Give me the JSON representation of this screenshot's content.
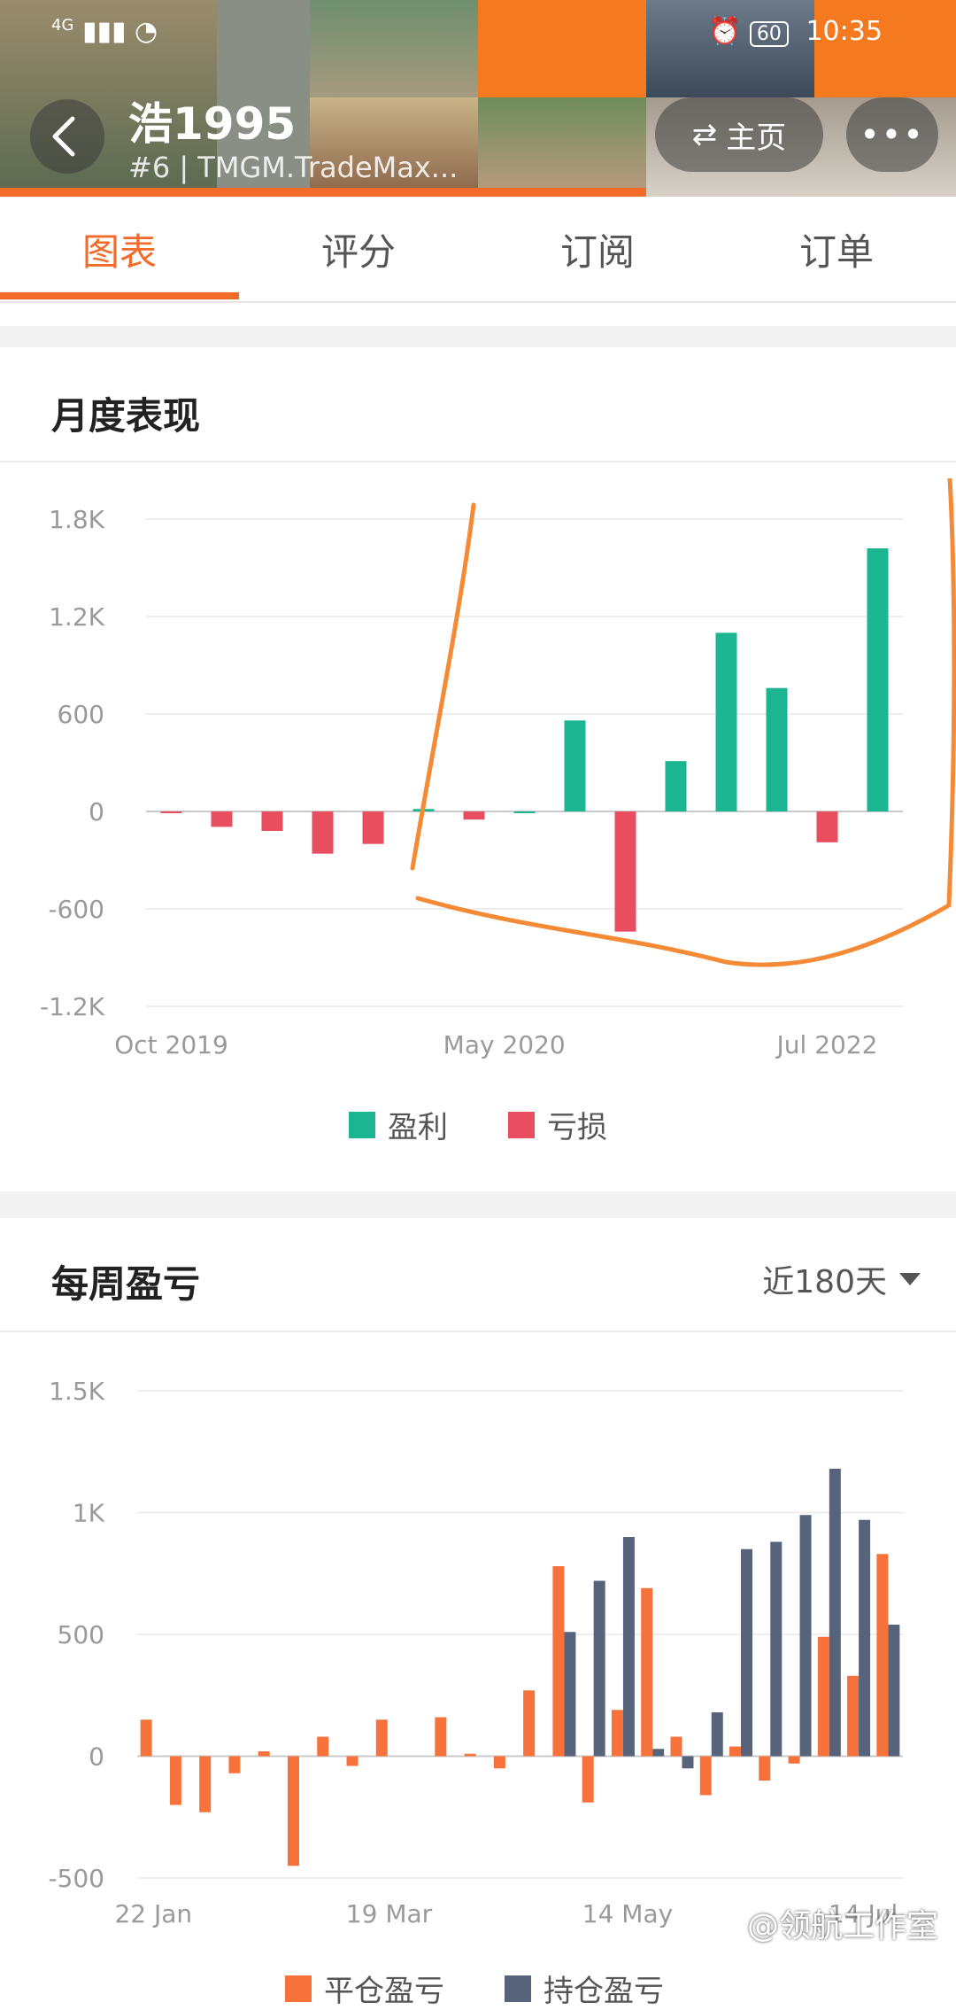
{
  "status_bar": {
    "network": "4G",
    "time": "10:35",
    "battery": "60"
  },
  "profile": {
    "name": "浩1995",
    "subtitle": "#6 | TMGM.TradeMax..."
  },
  "buttons": {
    "home_label": "主页",
    "more_label": "•••"
  },
  "tabs": [
    {
      "label": "图表"
    },
    {
      "label": "评分"
    },
    {
      "label": "订阅"
    },
    {
      "label": "订单"
    }
  ],
  "sections": {
    "monthly_title": "月度表现",
    "weekly_title": "每周盈亏",
    "weekly_filter": "近180天"
  },
  "watermark": "@领航工作室",
  "colors": {
    "accent": "#f26b29",
    "profit": "#1bb591",
    "loss": "#e84e5f",
    "closed": "#f7723a",
    "floating": "#56637a",
    "annotation": "#f58a36"
  },
  "chart_data": [
    {
      "type": "bar",
      "title": "月度表现",
      "y_ticks": [
        "1.8K",
        "1.2K",
        "600",
        "0",
        "-600",
        "-1.2K"
      ],
      "y_tick_values": [
        1800,
        1200,
        600,
        0,
        -600,
        -1200
      ],
      "x_tick_labels": [
        "Oct 2019",
        "May 2020",
        "Jul 2022"
      ],
      "legend": [
        "盈利",
        "亏损"
      ],
      "ylim": [
        -1200,
        1800
      ],
      "values": [
        -10,
        -95,
        -120,
        -260,
        -200,
        15,
        -50,
        0,
        560,
        -740,
        310,
        1100,
        760,
        -190,
        1620
      ]
    },
    {
      "type": "bar",
      "title": "每周盈亏",
      "y_ticks": [
        "1.5K",
        "1K",
        "500",
        "0",
        "-500"
      ],
      "y_tick_values": [
        1500,
        1000,
        500,
        0,
        -500
      ],
      "x_tick_labels": [
        "22 Jan",
        "19 Mar",
        "14 May",
        "14 Jul"
      ],
      "legend": [
        "平仓盈亏",
        "持仓盈亏"
      ],
      "ylim": [
        -500,
        1500
      ],
      "closed": [
        150,
        -200,
        -230,
        -70,
        20,
        -450,
        80,
        -40,
        150,
        0,
        160,
        10,
        -50,
        270,
        780,
        -190,
        190,
        690,
        80,
        -160,
        40,
        -100,
        -30,
        490,
        330,
        830
      ],
      "floating": [
        0,
        0,
        0,
        0,
        0,
        0,
        0,
        0,
        0,
        0,
        0,
        0,
        0,
        0,
        510,
        720,
        900,
        30,
        -50,
        180,
        850,
        880,
        990,
        1180,
        970,
        540
      ]
    }
  ]
}
